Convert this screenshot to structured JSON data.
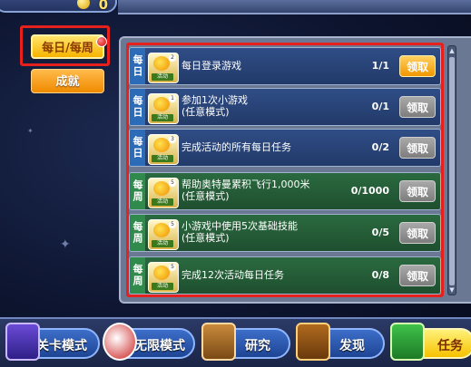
{
  "top": {
    "count": "0"
  },
  "categories": {
    "daily_weekly": "每日/每周",
    "achievements": "成就"
  },
  "tasks": [
    {
      "type": "daily",
      "tag": "每日",
      "level": "2",
      "title": "每日登录游戏",
      "note": "",
      "progress": "1/1",
      "claim": "领取",
      "claimable": true
    },
    {
      "type": "daily",
      "tag": "每日",
      "level": "1",
      "title": "参加1次小游戏",
      "note": "(任意模式)",
      "progress": "0/1",
      "claim": "领取",
      "claimable": false
    },
    {
      "type": "daily",
      "tag": "每日",
      "level": "3",
      "title": "完成活动的所有每日任务",
      "note": "",
      "progress": "0/2",
      "claim": "领取",
      "claimable": false
    },
    {
      "type": "weekly",
      "tag": "每周",
      "level": "5",
      "title": "帮助奥特曼累积飞行1,000米",
      "note": "(任意模式)",
      "progress": "0/1000",
      "claim": "领取",
      "claimable": false
    },
    {
      "type": "weekly",
      "tag": "每周",
      "level": "5",
      "title": "小游戏中使用5次基础技能",
      "note": "(任意模式)",
      "progress": "0/5",
      "claim": "领取",
      "claimable": false
    },
    {
      "type": "weekly",
      "tag": "每周",
      "level": "5",
      "title": "完成12次活动每日任务",
      "note": "",
      "progress": "0/8",
      "claim": "领取",
      "claimable": false
    }
  ],
  "icon_sub_label": "活动",
  "nav": {
    "stage_mode": "关卡模式",
    "endless_mode": "无限模式",
    "research": "研究",
    "discover": "发现",
    "tasks": "任务"
  }
}
